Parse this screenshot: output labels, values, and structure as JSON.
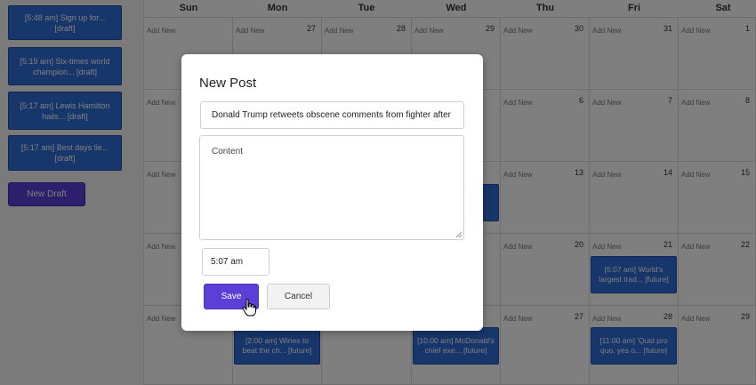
{
  "sidebar": {
    "drafts": [
      "[5:48 am] Sign up for... [draft]",
      "[5:19 am] Six-times world champion... [draft]",
      "[5:17 am] Lewis Hamilton hails... [draft]",
      "[5:17 am] Best days lie... [draft]"
    ],
    "new_draft_label": "New Draft"
  },
  "calendar": {
    "days": [
      "Sun",
      "Mon",
      "Tue",
      "Wed",
      "Thu",
      "Fri",
      "Sat"
    ],
    "add_new_label": "Add New",
    "day_numbers": [
      [
        "",
        "27",
        "28",
        "29",
        "30",
        "31",
        "1"
      ],
      [
        "",
        "",
        "",
        "",
        "6",
        "7",
        "8"
      ],
      [
        "",
        "",
        "",
        "",
        "13",
        "14",
        "15"
      ],
      [
        "",
        "",
        "",
        "",
        "20",
        "21",
        "22"
      ],
      [
        "",
        "",
        "",
        "",
        "27",
        "28",
        "29"
      ]
    ],
    "events": {
      "fri_22": "[5:07 am] World's largest trad... [future]",
      "mon_27": "[2:00 am] Wines to beat the ch... [future]",
      "wed_27": "[10:00 am] McDonald's chief exe... [future]",
      "fri_29": "[11:00 am] 'Quid pro quo, yes o... [future]"
    }
  },
  "modal": {
    "title": "New Post",
    "title_value": "Donald Trump retweets obscene comments from fighter after",
    "content_placeholder": "Content",
    "time_value": "5:07 am",
    "save_label": "Save",
    "cancel_label": "Cancel"
  },
  "colors": {
    "event_blue": "#2f6dd6",
    "accent_purple": "#5b3fd6"
  },
  "icons": {
    "cursor": "hand-pointer-icon",
    "resize": "resize-grip-icon"
  }
}
